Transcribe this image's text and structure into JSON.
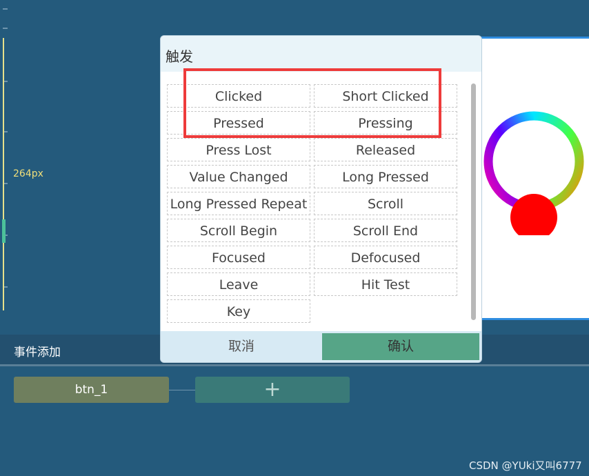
{
  "ruler": {
    "label": "264px"
  },
  "dialog": {
    "title": "触发",
    "events": [
      "Clicked",
      "Short Clicked",
      "Pressed",
      "Pressing",
      "Press Lost",
      "Released",
      "Value Changed",
      "Long Pressed",
      "Long Pressed Repeat",
      "Scroll",
      "Scroll Begin",
      "Scroll End",
      "Focused",
      "Defocused",
      "Leave",
      "Hit Test",
      "Key"
    ],
    "cancel_label": "取消",
    "confirm_label": "确认"
  },
  "event_panel": {
    "title": "事件添加",
    "node_label": "btn_1",
    "add_label": "+"
  },
  "watermark": "CSDN @YUki又叫6777",
  "colors": {
    "background": "#245a7c",
    "confirm": "#56a587",
    "highlight": "#ee3b3b",
    "accent": "#2f8de0"
  }
}
